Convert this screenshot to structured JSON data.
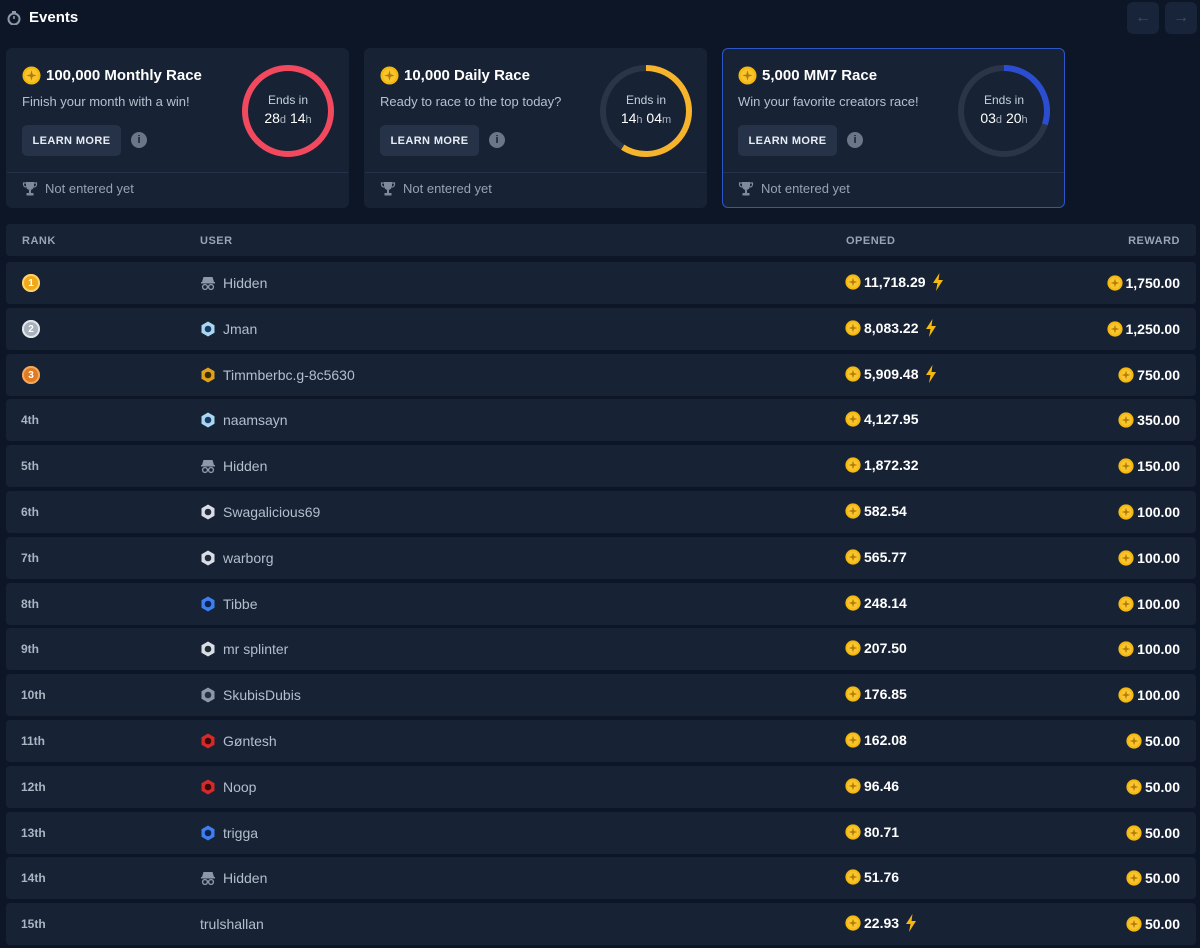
{
  "header": {
    "title": "Events",
    "prev_icon": "←",
    "next_icon": "→"
  },
  "colors": {
    "coin": "#f5b80d",
    "ring_red": "#f2495e",
    "ring_yellow": "#f7b32b",
    "ring_blue": "#2b4ed1",
    "track": "#2a3548"
  },
  "events": [
    {
      "title": "100,000 Monthly Race",
      "subtitle": "Finish your month with a win!",
      "learn_more": "LEARN MORE",
      "info": "i",
      "ends_label": "Ends in",
      "t1": "28",
      "u1": "d",
      "t2": "14",
      "u2": "h",
      "progress": 1.0,
      "ring_color": "#f2495e",
      "status": "Not entered yet",
      "active": false
    },
    {
      "title": "10,000 Daily Race",
      "subtitle": "Ready to race to the top today?",
      "learn_more": "LEARN MORE",
      "info": "i",
      "ends_label": "Ends in",
      "t1": "14",
      "u1": "h",
      "t2": "04",
      "u2": "m",
      "progress": 0.59,
      "ring_color": "#f7b32b",
      "status": "Not entered yet",
      "active": false
    },
    {
      "title": "5,000 MM7 Race",
      "subtitle": "Win your favorite creators race!",
      "learn_more": "LEARN MORE",
      "info": "i",
      "ends_label": "Ends in",
      "t1": "03",
      "u1": "d",
      "t2": "20",
      "u2": "h",
      "progress": 0.3,
      "ring_color": "#2b4ed1",
      "status": "Not entered yet",
      "active": true
    }
  ],
  "table": {
    "headers": {
      "rank": "RANK",
      "user": "USER",
      "opened": "OPENED",
      "reward": "REWARD"
    },
    "rows": [
      {
        "rank": "1",
        "medal": "gold",
        "user": "Hidden",
        "avatar": "hidden",
        "opened": "11,718.29",
        "bolt": true,
        "reward": "1,750.00"
      },
      {
        "rank": "2",
        "medal": "silver",
        "user": "Jman",
        "avatar": "light-blue",
        "opened": "8,083.22",
        "bolt": true,
        "reward": "1,250.00"
      },
      {
        "rank": "3",
        "medal": "bronze",
        "user": "Timmberbc.g-8c5630",
        "avatar": "gold",
        "opened": "5,909.48",
        "bolt": true,
        "reward": "750.00"
      },
      {
        "rank": "4th",
        "medal": null,
        "user": "naamsayn",
        "avatar": "light-blue",
        "opened": "4,127.95",
        "bolt": false,
        "reward": "350.00"
      },
      {
        "rank": "5th",
        "medal": null,
        "user": "Hidden",
        "avatar": "hidden",
        "opened": "1,872.32",
        "bolt": false,
        "reward": "150.00"
      },
      {
        "rank": "6th",
        "medal": null,
        "user": "Swagalicious69",
        "avatar": "white",
        "opened": "582.54",
        "bolt": false,
        "reward": "100.00"
      },
      {
        "rank": "7th",
        "medal": null,
        "user": "warborg",
        "avatar": "white",
        "opened": "565.77",
        "bolt": false,
        "reward": "100.00"
      },
      {
        "rank": "8th",
        "medal": null,
        "user": "Tibbe",
        "avatar": "blue",
        "opened": "248.14",
        "bolt": false,
        "reward": "100.00"
      },
      {
        "rank": "9th",
        "medal": null,
        "user": "mr splinter",
        "avatar": "white",
        "opened": "207.50",
        "bolt": false,
        "reward": "100.00"
      },
      {
        "rank": "10th",
        "medal": null,
        "user": "SkubisDubis",
        "avatar": "grey",
        "opened": "176.85",
        "bolt": false,
        "reward": "100.00"
      },
      {
        "rank": "11th",
        "medal": null,
        "user": "Gøntesh",
        "avatar": "red",
        "opened": "162.08",
        "bolt": false,
        "reward": "50.00"
      },
      {
        "rank": "12th",
        "medal": null,
        "user": "Noop",
        "avatar": "red",
        "opened": "96.46",
        "bolt": false,
        "reward": "50.00"
      },
      {
        "rank": "13th",
        "medal": null,
        "user": "trigga",
        "avatar": "blue",
        "opened": "80.71",
        "bolt": false,
        "reward": "50.00"
      },
      {
        "rank": "14th",
        "medal": null,
        "user": "Hidden",
        "avatar": "hidden",
        "opened": "51.76",
        "bolt": false,
        "reward": "50.00"
      },
      {
        "rank": "15th",
        "medal": null,
        "user": "trulshallan",
        "avatar": null,
        "opened": "22.93",
        "bolt": true,
        "reward": "50.00"
      }
    ]
  }
}
